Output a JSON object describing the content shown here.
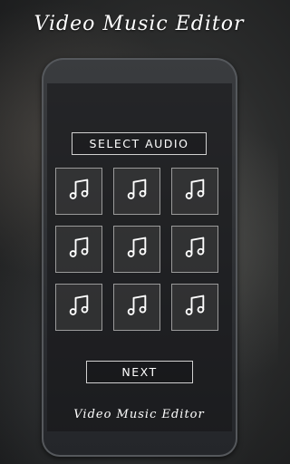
{
  "header": {
    "title": "Video Music Editor"
  },
  "main": {
    "select_audio_label": "SELECT AUDIO",
    "next_label": "NEXT",
    "audio_slots": [
      {
        "icon": "music-note-icon"
      },
      {
        "icon": "music-note-icon"
      },
      {
        "icon": "music-note-icon"
      },
      {
        "icon": "music-note-icon"
      },
      {
        "icon": "music-note-icon"
      },
      {
        "icon": "music-note-icon"
      },
      {
        "icon": "music-note-icon"
      },
      {
        "icon": "music-note-icon"
      },
      {
        "icon": "music-note-icon"
      }
    ]
  },
  "footer": {
    "title": "Video Music Editor"
  },
  "colors": {
    "text": "#ffffff",
    "border": "#d0d0d0",
    "background": "#2b2c2c"
  }
}
